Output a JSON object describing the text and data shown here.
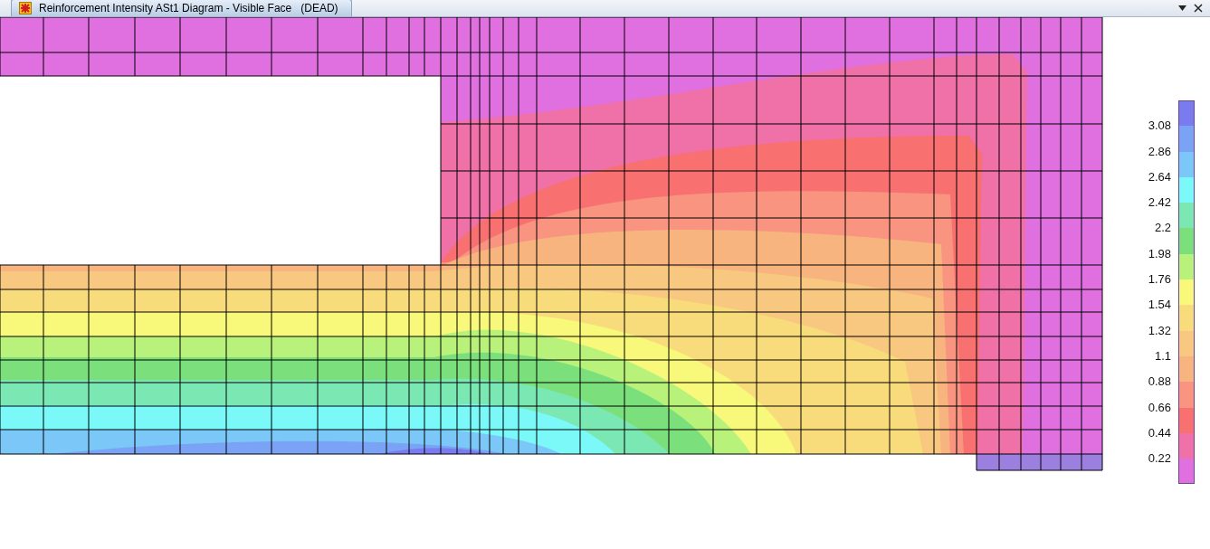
{
  "window": {
    "title": "Reinforcement Intensity ASt1 Diagram - Visible Face   (DEAD)"
  },
  "legend": {
    "bands": [
      {
        "color": "#7b7bf0"
      },
      {
        "color": "#7ba3f5"
      },
      {
        "color": "#7bc8f8"
      },
      {
        "color": "#7bf8f8"
      },
      {
        "color": "#7be8b4"
      },
      {
        "color": "#7be07b"
      },
      {
        "color": "#b8f27b"
      },
      {
        "color": "#f8f87b"
      },
      {
        "color": "#f8dc7b"
      },
      {
        "color": "#f8c880"
      },
      {
        "color": "#f8b47f"
      },
      {
        "color": "#f8947f"
      },
      {
        "color": "#f87070"
      },
      {
        "color": "#f070a8"
      },
      {
        "color": "#e070e0"
      }
    ],
    "labels": [
      "3.08",
      "2.86",
      "2.64",
      "2.42",
      "2.2",
      "1.98",
      "1.76",
      "1.54",
      "1.32",
      "1.1",
      "0.88",
      "0.66",
      "0.44",
      "0.22"
    ]
  }
}
